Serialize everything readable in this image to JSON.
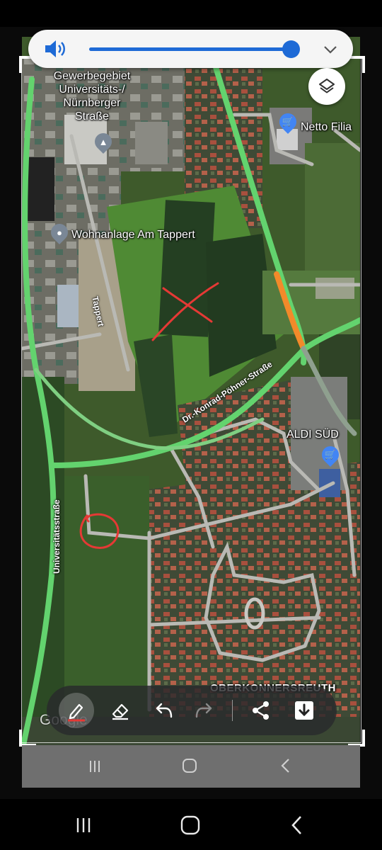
{
  "volume": {
    "level_percent": 92,
    "speaker_icon": "speaker-icon",
    "expand_icon": "chevron-down-icon",
    "accent": "#1e6ad6"
  },
  "map": {
    "labels": {
      "gewerbe": "Gewerbegebiet\nUniversitäts-/\nNürnberger\nStraße",
      "wohnanlage": "Wohnanlage Am Tappert",
      "netto": "Netto Filia",
      "aldi": "ALDI SÜD",
      "oberkonnersreuth": "OBERKONNERSREUTH"
    },
    "roads": {
      "tappert": "Tappert",
      "poehner": "Dr.-Konrad-Pöhner-Straße",
      "universitaet": "Universitätsstraße"
    },
    "attribution": "Google",
    "annotation_color": "#e53935"
  },
  "toolbar": {
    "tools": [
      "pen-icon",
      "eraser-icon",
      "undo-icon",
      "redo-icon",
      "share-icon",
      "save-icon"
    ]
  },
  "colors": {
    "traffic_green": "#63d36e",
    "traffic_orange": "#f28a2a"
  }
}
